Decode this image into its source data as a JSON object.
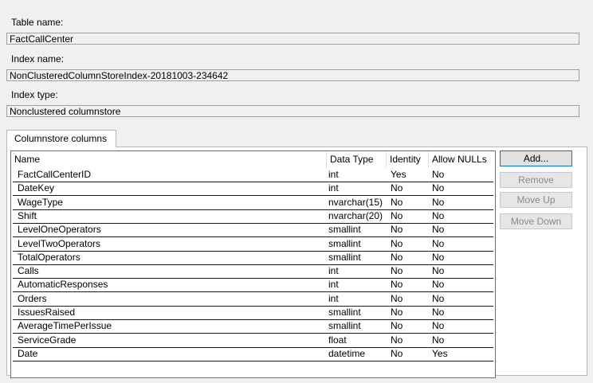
{
  "table_name": {
    "label": "Table name:",
    "value": "FactCallCenter"
  },
  "index_name": {
    "label": "Index name:",
    "value": "NonClusteredColumnStoreIndex-20181003-234642"
  },
  "index_type": {
    "label": "Index type:",
    "value": "Nonclustered columnstore"
  },
  "tab": {
    "label": "Columnstore columns"
  },
  "grid": {
    "headers": [
      "Name",
      "Data Type",
      "Identity",
      "Allow NULLs"
    ],
    "rows": [
      [
        "FactCallCenterID",
        "int",
        "Yes",
        "No"
      ],
      [
        "DateKey",
        "int",
        "No",
        "No"
      ],
      [
        "WageType",
        "nvarchar(15)",
        "No",
        "No"
      ],
      [
        "Shift",
        "nvarchar(20)",
        "No",
        "No"
      ],
      [
        "LevelOneOperators",
        "smallint",
        "No",
        "No"
      ],
      [
        "LevelTwoOperators",
        "smallint",
        "No",
        "No"
      ],
      [
        "TotalOperators",
        "smallint",
        "No",
        "No"
      ],
      [
        "Calls",
        "int",
        "No",
        "No"
      ],
      [
        "AutomaticResponses",
        "int",
        "No",
        "No"
      ],
      [
        "Orders",
        "int",
        "No",
        "No"
      ],
      [
        "IssuesRaised",
        "smallint",
        "No",
        "No"
      ],
      [
        "AverageTimePerIssue",
        "smallint",
        "No",
        "No"
      ],
      [
        "ServiceGrade",
        "float",
        "No",
        "No"
      ],
      [
        "Date",
        "datetime",
        "No",
        "Yes"
      ]
    ]
  },
  "buttons": {
    "add": "Add...",
    "remove": "Remove",
    "move_up": "Move Up",
    "move_down": "Move Down"
  }
}
